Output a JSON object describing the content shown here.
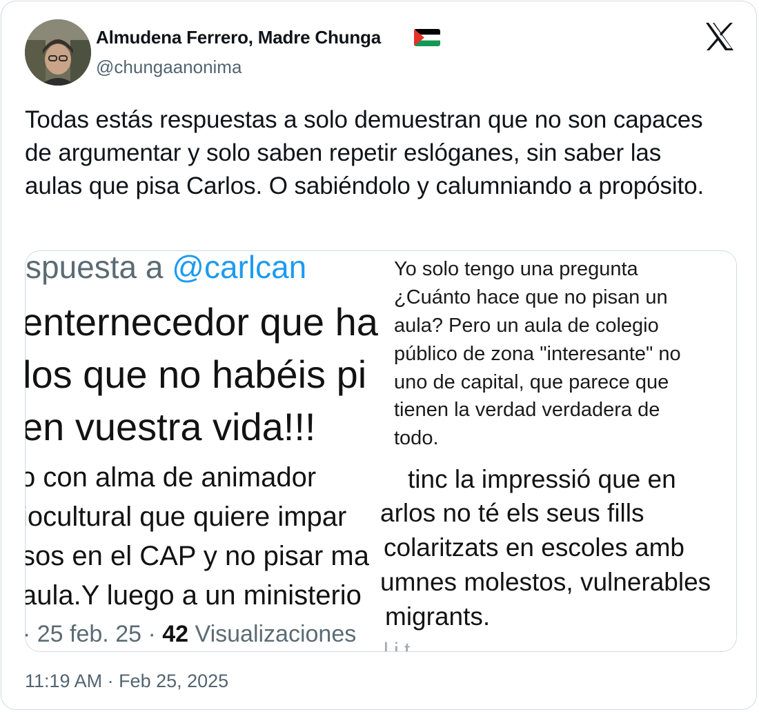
{
  "author": {
    "display_name": "Almudena Ferrero, Madre Chunga",
    "handle": "@chungaanonima",
    "flag_icon": "palestine-flag-icon"
  },
  "platform_icon": "x-logo-icon",
  "tweet": {
    "text": "Todas estás respuestas a  solo demuestran que no son capaces de argumentar y solo saben repetir eslóganes, sin saber las aulas que pisa Carlos. O sabiéndolo y calumniando a propósito."
  },
  "media": {
    "left_screenshot": {
      "reply_prefix": "spuesta a ",
      "reply_mention": "@carlcan",
      "lines": [
        "enternecedor que ha",
        "los que no habéis pi",
        "en vuestra vida!!!",
        "o con alma de animador",
        "iocultural que quiere impar",
        "sos en el CAP y no pisar ma",
        "aula.Y luego a un ministerio"
      ],
      "meta_prefix": "· 25 feb. 25 · ",
      "meta_views_count": "42",
      "meta_views_label": " Visualizaciones"
    },
    "right_top_screenshot": {
      "lines": [
        "Yo solo tengo una pregunta",
        "¿Cuánto hace que no pisan un",
        "aula? Pero un aula de colegio",
        "público de zona \"interesante\" no",
        "uno de capital, que parece que",
        "tienen la verdad verdadera de",
        "todo."
      ]
    },
    "right_bottom_screenshot": {
      "lines": [
        "tinc la impressió que en",
        "arlos no té els seus fills",
        "colaritzats en escoles amb",
        "umnes molestos, vulnerables",
        "migrants."
      ],
      "cut_off_text": "l  i    t"
    }
  },
  "timestamp": "11:19 AM · Feb 25, 2025",
  "colors": {
    "text_primary": "#0f1419",
    "text_secondary": "#536471",
    "border": "#cfd9de",
    "link": "#1d9bf0"
  }
}
